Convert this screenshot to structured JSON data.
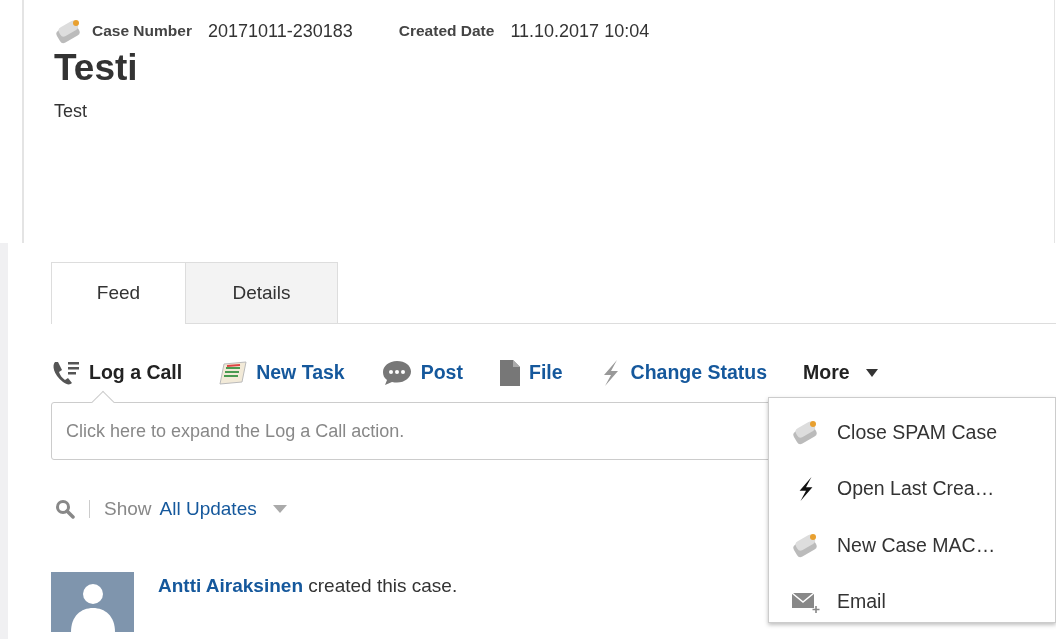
{
  "header": {
    "case_number_label": "Case Number",
    "case_number": "20171011-230183",
    "created_date_label": "Created Date",
    "created_date": "11.10.2017 10:04",
    "title": "Testi",
    "description": "Test"
  },
  "tabs": [
    {
      "label": "Feed",
      "selected": true
    },
    {
      "label": "Details",
      "selected": false
    }
  ],
  "actions": [
    {
      "label": "Log a Call",
      "kind": "phone",
      "selected": true
    },
    {
      "label": "New Task",
      "kind": "task",
      "selected": false
    },
    {
      "label": "Post",
      "kind": "post",
      "selected": false
    },
    {
      "label": "File",
      "kind": "file",
      "selected": false
    },
    {
      "label": "Change Status",
      "kind": "bolt",
      "selected": false
    }
  ],
  "more": {
    "label": "More",
    "items": [
      {
        "label": "Close SPAM Case",
        "kind": "case"
      },
      {
        "label": "Open Last Crea…",
        "kind": "bolt"
      },
      {
        "label": "New Case MAC…",
        "kind": "case"
      },
      {
        "label": "Email",
        "kind": "mail"
      }
    ]
  },
  "composer": {
    "placeholder": "Click here to expand the Log a Call action."
  },
  "filter": {
    "prefix": "Show",
    "value": "All Updates"
  },
  "feed": [
    {
      "author": "Antti Airaksinen",
      "text": "created this case."
    }
  ]
}
